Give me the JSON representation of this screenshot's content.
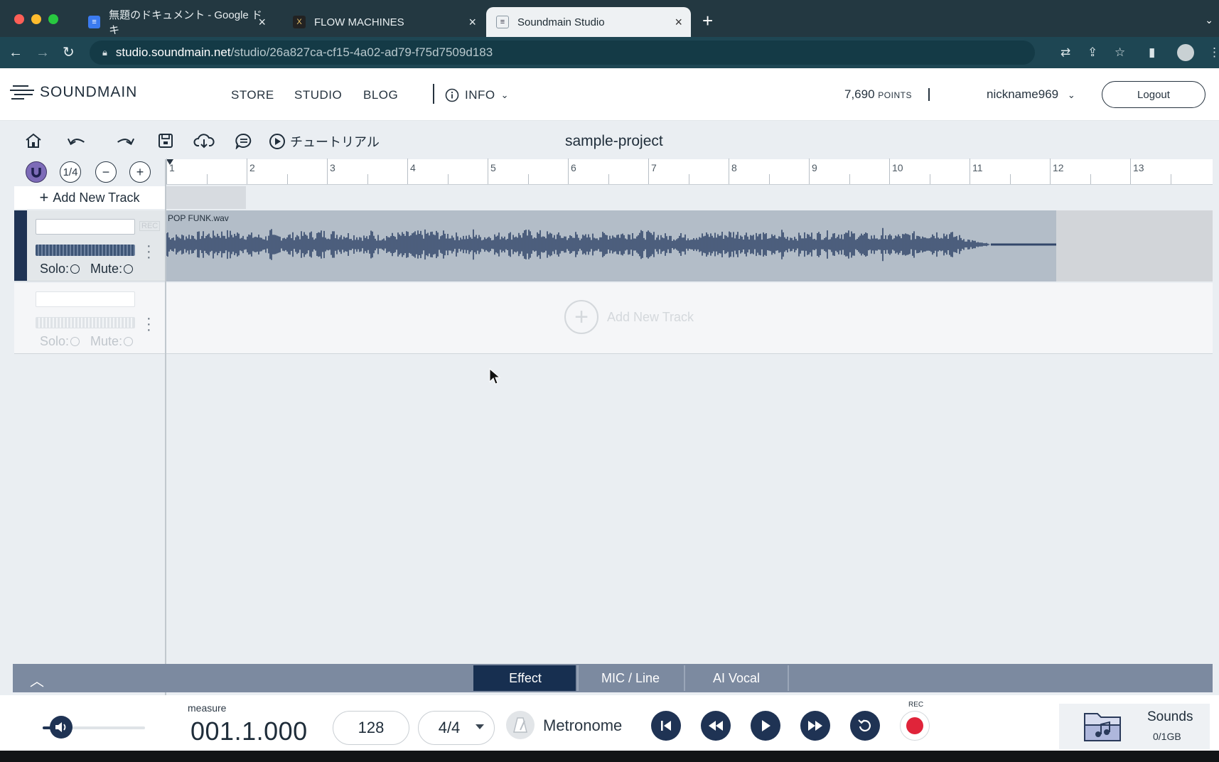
{
  "browser": {
    "tabs": [
      {
        "title": "無題のドキュメント - Google ドキ",
        "favicon": "google-docs-icon",
        "active": false
      },
      {
        "title": "FLOW MACHINES",
        "favicon": "flow-machines-icon",
        "active": false
      },
      {
        "title": "Soundmain Studio",
        "favicon": "soundmain-icon",
        "active": true
      }
    ],
    "new_tab": "+",
    "url_host": "studio.soundmain.net",
    "url_path": "/studio/26a827ca-cf15-4a02-ad79-f75d7509d183"
  },
  "header": {
    "logo": "SOUNDMAIN",
    "nav": [
      "STORE",
      "STUDIO",
      "BLOG"
    ],
    "info_label": "INFO",
    "points_value": "7,690",
    "points_unit": "POINTS",
    "username": "nickname969",
    "logout_label": "Logout"
  },
  "toolbar": {
    "tutorial_label": "チュートリアル",
    "project_name": "sample-project",
    "quantize_label": "1/4"
  },
  "timeline": {
    "measures": [
      "1",
      "2",
      "3",
      "4",
      "5",
      "6",
      "7",
      "8",
      "9",
      "10",
      "11",
      "12",
      "13"
    ],
    "add_track_label": "Add New Track"
  },
  "tracks": [
    {
      "clip_name": "POP FUNK.wav",
      "rec_label": "REC",
      "solo_label": "Solo:",
      "mute_label": "Mute:"
    },
    {
      "empty_label": "Add New Track",
      "solo_label": "Solo:",
      "mute_label": "Mute:"
    }
  ],
  "bottom_tabs": [
    "Effect",
    "MIC / Line",
    "AI Vocal"
  ],
  "transport": {
    "measure_label": "measure",
    "measure_value": "001.1.000",
    "tempo": "128",
    "time_signature": "4/4",
    "metronome_label": "Metronome",
    "rec_label": "REC",
    "volume_level": 0.18
  },
  "sounds": {
    "label": "Sounds",
    "usage": "0/1GB"
  },
  "colors": {
    "accent_dark": "#1f3354",
    "clip_bg": "#b3bdc8",
    "wave": "#33476a",
    "rec": "#e0243a"
  }
}
